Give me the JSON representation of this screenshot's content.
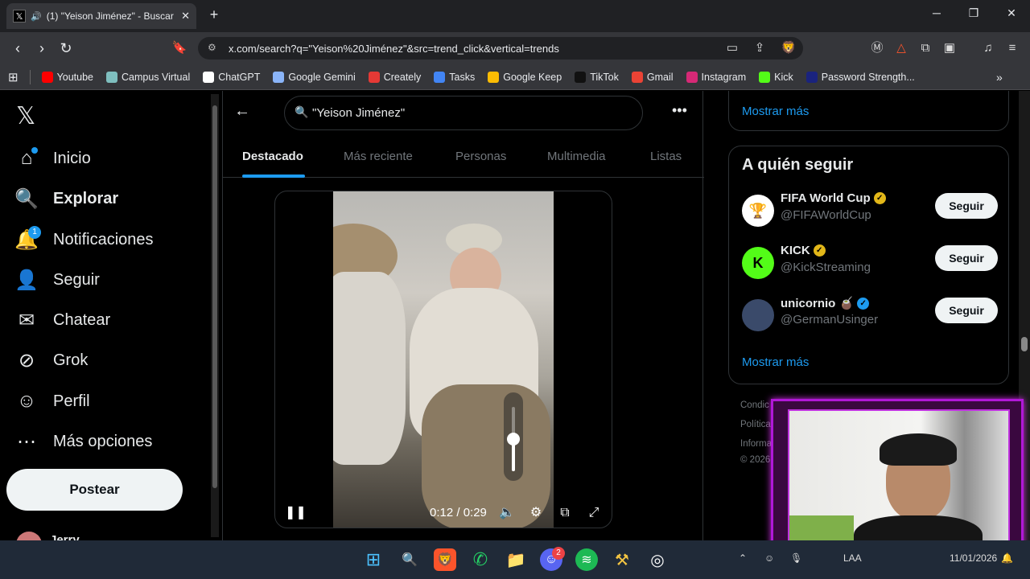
{
  "browser": {
    "tab_title": "(1) \"Yeison Jiménez\" - Buscar",
    "url": "x.com/search?q=\"Yeison%20Jiménez\"&src=trend_click&vertical=trends",
    "bookmarks": [
      {
        "label": "Youtube",
        "color": "#ff0000"
      },
      {
        "label": "Campus Virtual",
        "color": "#7fbfbf"
      },
      {
        "label": "ChatGPT",
        "color": "#ffffff"
      },
      {
        "label": "Google Gemini",
        "color": "#8ab4f8"
      },
      {
        "label": "Creately",
        "color": "#e53935"
      },
      {
        "label": "Tasks",
        "color": "#4285f4"
      },
      {
        "label": "Google Keep",
        "color": "#fbbc04"
      },
      {
        "label": "TikTok",
        "color": "#111111"
      },
      {
        "label": "Gmail",
        "color": "#ea4335"
      },
      {
        "label": "Instagram",
        "color": "#d62976"
      },
      {
        "label": "Kick",
        "color": "#53fc18"
      },
      {
        "label": "Password Strength...",
        "color": "#1a237e"
      }
    ]
  },
  "sidebar": {
    "items": [
      {
        "label": "Inicio",
        "icon": "home-icon"
      },
      {
        "label": "Explorar",
        "icon": "search-icon"
      },
      {
        "label": "Notificaciones",
        "icon": "bell-icon",
        "badge": "1"
      },
      {
        "label": "Seguir",
        "icon": "add-user-icon"
      },
      {
        "label": "Chatear",
        "icon": "mail-icon"
      },
      {
        "label": "Grok",
        "icon": "grok-icon"
      },
      {
        "label": "Perfil",
        "icon": "person-icon"
      },
      {
        "label": "Más opciones",
        "icon": "more-circle-icon"
      }
    ],
    "post_label": "Postear",
    "user_partial": "Jerry"
  },
  "main": {
    "search_value": "\"Yeison Jiménez\"",
    "tabs": [
      "Destacado",
      "Más reciente",
      "Personas",
      "Multimedia",
      "Listas"
    ],
    "active_tab": "Destacado",
    "video": {
      "time": "0:12 / 0:29",
      "volume_level": 0.5,
      "playing": true
    }
  },
  "right": {
    "show_more": "Mostrar más",
    "follow_title": "A quién seguir",
    "follow_button": "Seguir",
    "accounts": [
      {
        "name": "FIFA World Cup",
        "handle": "@FIFAWorldCup",
        "verified": "gold",
        "avatar_color": "#ffffff"
      },
      {
        "name": "KICK",
        "handle": "@KickStreaming",
        "verified": "gold",
        "avatar_color": "#53fc18"
      },
      {
        "name": "unicornio 🧉",
        "handle": "@GermanUsinger",
        "verified": "blue",
        "avatar_color": "#3a4a6a"
      }
    ],
    "footer": [
      "Condic",
      "Política",
      "Informa",
      "© 2026 X"
    ]
  },
  "taskbar": {
    "discord_badge": "2",
    "lang": "LAA",
    "date_partial": "11/01/2026"
  }
}
